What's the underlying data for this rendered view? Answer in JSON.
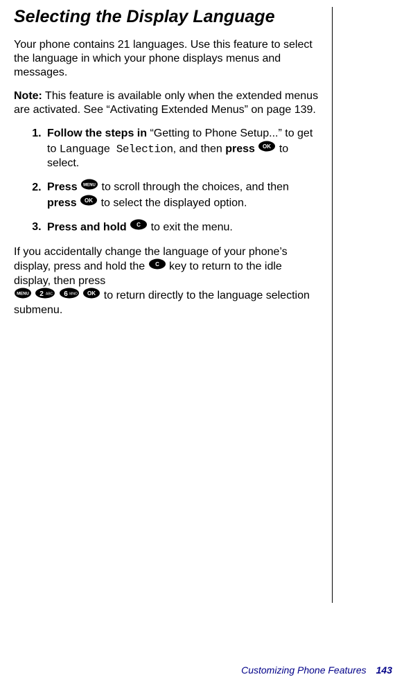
{
  "title": "Selecting the Display Language",
  "intro": "Your phone contains 21 languages. Use this feature to select the language in which your phone displays menus and messages.",
  "note_label": "Note:",
  "note_body": " This feature is available only when the extended menus are activated. See “Activating Extended Menus” on page 139.",
  "steps": {
    "s1": {
      "a": "Follow the steps in",
      "b": " “Getting to Phone Setup...” to get to ",
      "lcd": "Language Selection",
      "c": ", and then ",
      "d": "press ",
      "e": " to select."
    },
    "s2": {
      "a": "Press ",
      "b": " to scroll through the choices, and then ",
      "c": "press ",
      "d": " to select the displayed option."
    },
    "s3": {
      "a": "Press and hold ",
      "b": " to exit the menu."
    }
  },
  "recover": {
    "a": "If you accidentally change the language of your phone’s display, press and hold the ",
    "b": " key to return to the idle display, then press",
    "c": " to return directly to the language selection submenu."
  },
  "icons": {
    "ok": "OK",
    "menu": "MENU",
    "c": "C",
    "two": "2",
    "two_sub": "ABC",
    "six": "6",
    "six_sub": "MNO"
  },
  "footer": {
    "section": "Customizing Phone Features",
    "page": "143"
  }
}
